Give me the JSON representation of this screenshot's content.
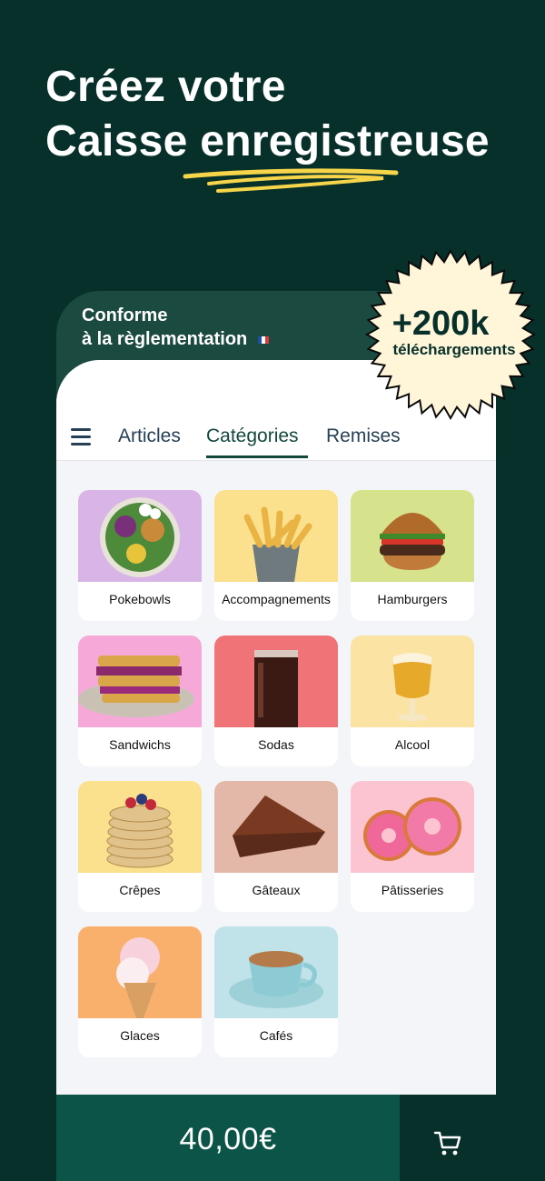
{
  "headline": {
    "line1": "Créez votre",
    "line2": "Caisse enregistreuse"
  },
  "badge": {
    "count": "+200k",
    "label": "téléchargements"
  },
  "compliance": {
    "line1": "Conforme",
    "line2": "à la règlementation"
  },
  "tabs": [
    {
      "label": "Articles",
      "active": false
    },
    {
      "label": "Catégories",
      "active": true
    },
    {
      "label": "Remises",
      "active": false
    }
  ],
  "categories": [
    {
      "label": "Pokebowls",
      "bg": "#d9b4e6",
      "icon": "pokebowl-icon"
    },
    {
      "label": "Accompagnements",
      "bg": "#fbe08e",
      "icon": "fries-icon"
    },
    {
      "label": "Hamburgers",
      "bg": "#d7e28d",
      "icon": "burger-icon"
    },
    {
      "label": "Sandwichs",
      "bg": "#f6a9d8",
      "icon": "sandwich-icon"
    },
    {
      "label": "Sodas",
      "bg": "#f07377",
      "icon": "soda-icon"
    },
    {
      "label": "Alcool",
      "bg": "#fbe3a4",
      "icon": "beer-icon"
    },
    {
      "label": "Crêpes",
      "bg": "#fbe08e",
      "icon": "pancakes-icon"
    },
    {
      "label": "Gâteaux",
      "bg": "#e3b8a8",
      "icon": "cake-icon"
    },
    {
      "label": "Pâtisseries",
      "bg": "#fbc4d0",
      "icon": "donut-icon"
    },
    {
      "label": "Glaces",
      "bg": "#f8b06c",
      "icon": "icecream-icon"
    },
    {
      "label": "Cafés",
      "bg": "#bfe3e8",
      "icon": "coffee-icon"
    }
  ],
  "cart": {
    "total": "40,00€"
  },
  "colors": {
    "background": "#07302a",
    "accent": "#0c5447",
    "highlight": "#f6d54a",
    "badge": "#fff6da"
  }
}
